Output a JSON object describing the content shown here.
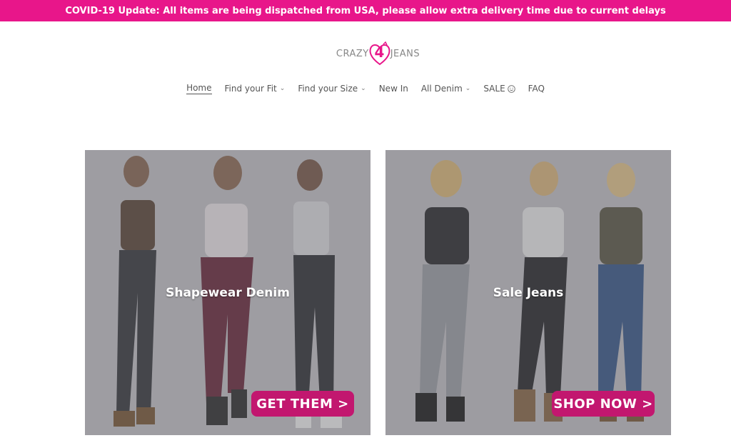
{
  "announcement": "COVID-19 Update: All items are being dispatched from USA, please allow extra delivery time due to current delays",
  "logo": {
    "left": "CRAZY",
    "number": "4",
    "right": "JEANS"
  },
  "nav": [
    {
      "label": "Home",
      "dropdown": false,
      "active": true
    },
    {
      "label": "Find your Fit",
      "dropdown": true
    },
    {
      "label": "Find your Size",
      "dropdown": true
    },
    {
      "label": "New In",
      "dropdown": false
    },
    {
      "label": "All Denim",
      "dropdown": true
    },
    {
      "label": "SALE",
      "dropdown": false,
      "icon": "smile-icon"
    },
    {
      "label": "FAQ",
      "dropdown": false
    }
  ],
  "cards": [
    {
      "title": "Shapewear Denim",
      "cta": "GET THEM >"
    },
    {
      "title": "Sale Jeans",
      "cta": "SHOP NOW >"
    }
  ],
  "colors": {
    "brand": "#e8168a",
    "cta": "#c2176f"
  }
}
